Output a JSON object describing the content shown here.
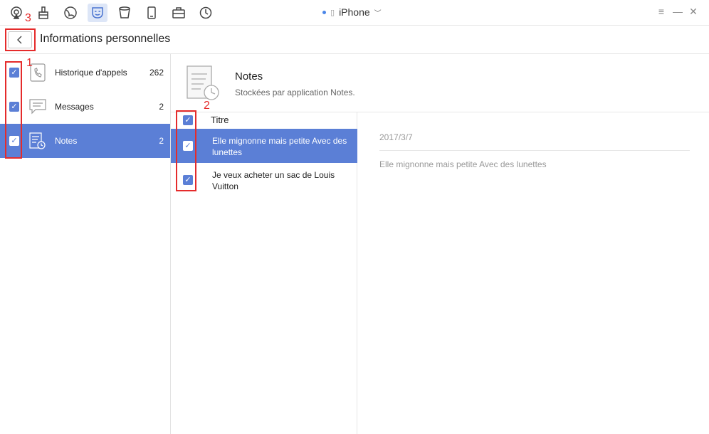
{
  "toolbar": {
    "icons": [
      "airplay-icon",
      "cleaner-icon",
      "globe-icon",
      "mask-icon",
      "trash-icon",
      "phone-icon",
      "toolbox-icon",
      "history-icon"
    ],
    "active_icon": "mask-icon",
    "device": "iPhone",
    "window_controls": [
      "≡",
      "—",
      "✕"
    ]
  },
  "header": {
    "back_label": "<",
    "title": "Informations personnelles"
  },
  "annotations": {
    "n1": "1",
    "n2": "2",
    "n3": "3"
  },
  "categories": [
    {
      "label": "Historique d'appels",
      "count": "262",
      "checked": true,
      "selected": false,
      "icon": "call-history-icon"
    },
    {
      "label": "Messages",
      "count": "2",
      "checked": true,
      "selected": false,
      "icon": "message-icon"
    },
    {
      "label": "Notes",
      "count": "2",
      "checked": true,
      "selected": true,
      "icon": "notes-icon"
    }
  ],
  "notes_header": {
    "title": "Notes",
    "subtitle": "Stockées par application Notes."
  },
  "list": {
    "column_title": "Titre",
    "rows": [
      {
        "text": "Elle mignonne mais petite Avec des lunettes",
        "selected": true
      },
      {
        "text": "Je veux acheter un sac de Louis Vuitton",
        "selected": false
      }
    ]
  },
  "detail": {
    "date": "2017/3/7",
    "body": "Elle mignonne mais petite Avec des lunettes"
  },
  "colors": {
    "accent": "#5b7fd6",
    "annotation": "#e52b2b"
  }
}
